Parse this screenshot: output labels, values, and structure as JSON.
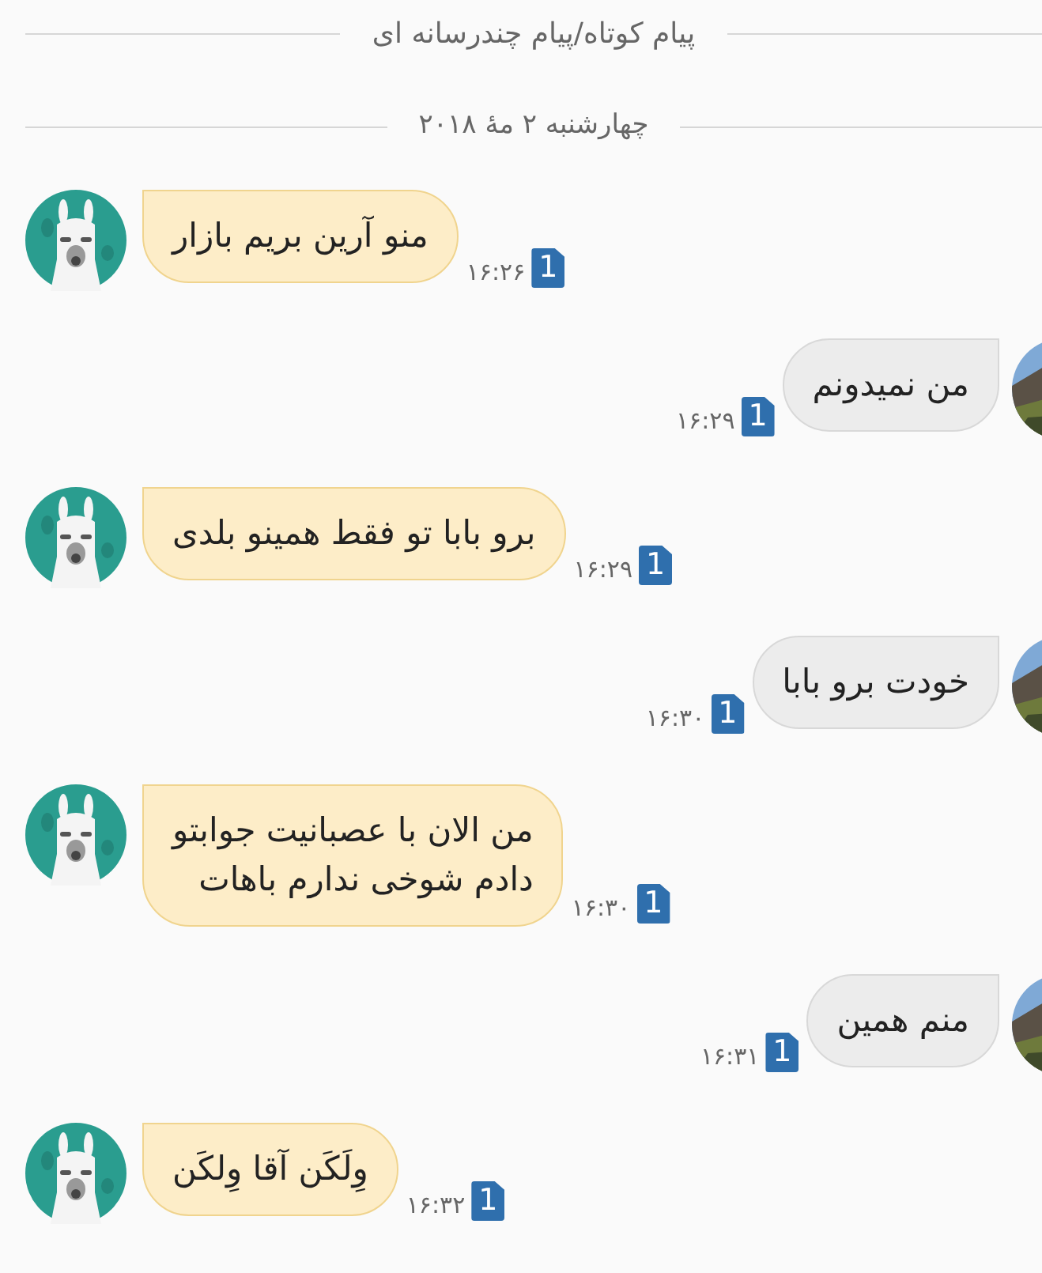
{
  "header": {
    "title": "پیام کوتاه/پیام چندرسانه ای"
  },
  "date": "چهارشنبه ۲ مهٔ ۲۰۱۸",
  "messages": [
    {
      "kind": "incoming",
      "lines": [
        "منو آرین بریم بازار"
      ],
      "time": "۱۶:۲۶",
      "sim": "1"
    },
    {
      "kind": "outgoing",
      "lines": [
        "من نمیدونم"
      ],
      "time": "۱۶:۲۹",
      "sim": "1"
    },
    {
      "kind": "incoming",
      "lines": [
        "برو بابا تو فقط همینو بلدی"
      ],
      "time": "۱۶:۲۹",
      "sim": "1"
    },
    {
      "kind": "outgoing",
      "lines": [
        "خودت برو بابا"
      ],
      "time": "۱۶:۳۰",
      "sim": "1"
    },
    {
      "kind": "incoming",
      "lines": [
        "من الان با عصبانیت جوابتو",
        "دادم شوخی ندارم باهات"
      ],
      "time": "۱۶:۳۰",
      "sim": "1"
    },
    {
      "kind": "outgoing",
      "lines": [
        "منم همین"
      ],
      "time": "۱۶:۳۱",
      "sim": "1"
    },
    {
      "kind": "incoming",
      "lines": [
        "وِلَکَن آقا وِلکَن"
      ],
      "time": "۱۶:۳۲",
      "sim": "1"
    }
  ]
}
